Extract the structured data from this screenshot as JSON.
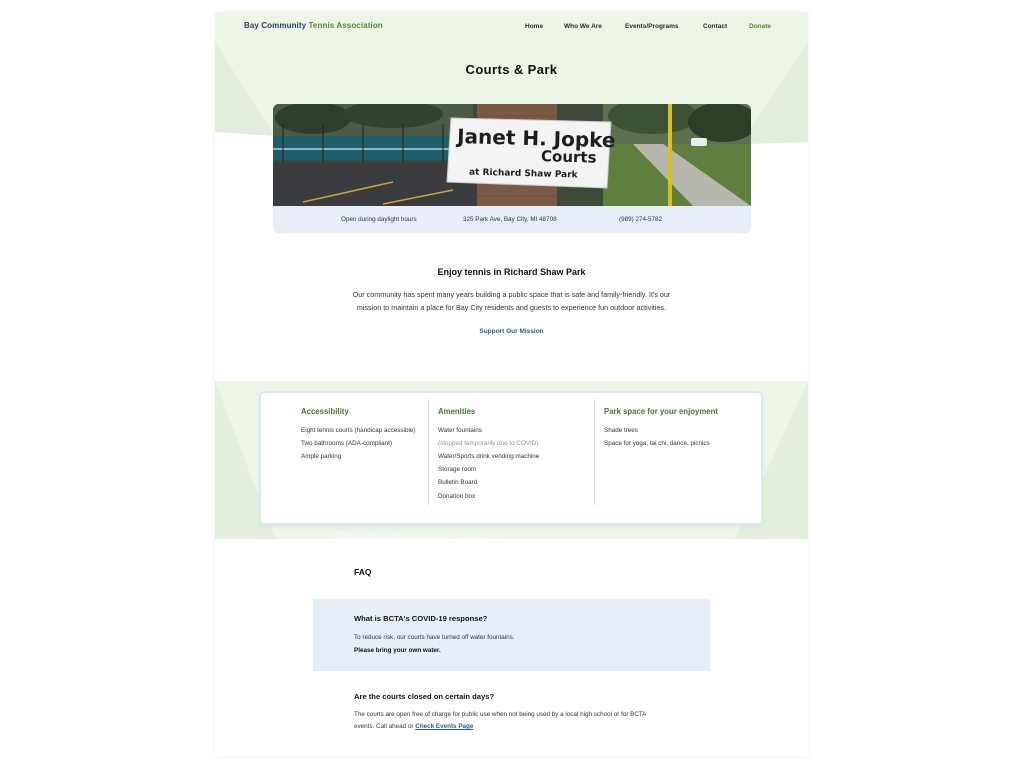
{
  "brand": {
    "part1": "Bay Community",
    "part2": "Tennis Association"
  },
  "nav": {
    "home": "Home",
    "who_we_are": "Who We Are",
    "events": "Events/Programs",
    "contact": "Contact",
    "donate": "Donate"
  },
  "page_title": "Courts & Park",
  "banner": {
    "sign_line1": "Janet H. Jopke",
    "sign_line2": "Courts",
    "sign_line3": "at  Richard Shaw Park",
    "hours": "Open during daylight hours",
    "address": "325 Park Ave, Bay City, MI 48708",
    "phone": "(989) 274-5782"
  },
  "intro": {
    "title": "Enjoy tennis in Richard Shaw Park",
    "line1": "Our community has spent many years building a public space that is safe and family-friendly.  It's our",
    "line2": "mission to maintain a place for Bay City residents and guests to experience fun outdoor activities.",
    "cta": "Support Our Mission"
  },
  "features": {
    "accessibility": {
      "heading": "Accessibility",
      "items": [
        "Eight tennis courts (handicap accessible)",
        "Two bathrooms (ADA-compliant)",
        "Ample parking"
      ]
    },
    "amenities": {
      "heading": "Amenities",
      "items": [
        "Water fountains",
        "(stopped temporarily due to COVID)",
        "Water/Sports drink vending machine",
        "Storage room",
        "Bulletin Board",
        "Donation box"
      ]
    },
    "park": {
      "heading": "Park space for your enjoyment",
      "items": [
        "Shade trees",
        "Space for yoga, tai chi, dance, picnics"
      ]
    }
  },
  "faq": {
    "title": "FAQ",
    "q1": "What is BCTA's COVID-19 response?",
    "a1_line1": "To reduce risk, our courts have turned off water fountains.",
    "a1_line2": "Please bring your own water.",
    "q2": "Are the courts closed on certain days?",
    "a2_line1": "The courts are open free of charge for public use when not being used by a local high school or for BCTA",
    "a2_line2": "events.  Call ahead or ",
    "a2_link": "Check Events Page"
  },
  "colors": {
    "brand_navy": "#1e4563",
    "brand_green": "#4e8a38",
    "band_green": "#ecf5e6",
    "panel_blue": "#e6eff8",
    "link_blue": "#24618f"
  }
}
